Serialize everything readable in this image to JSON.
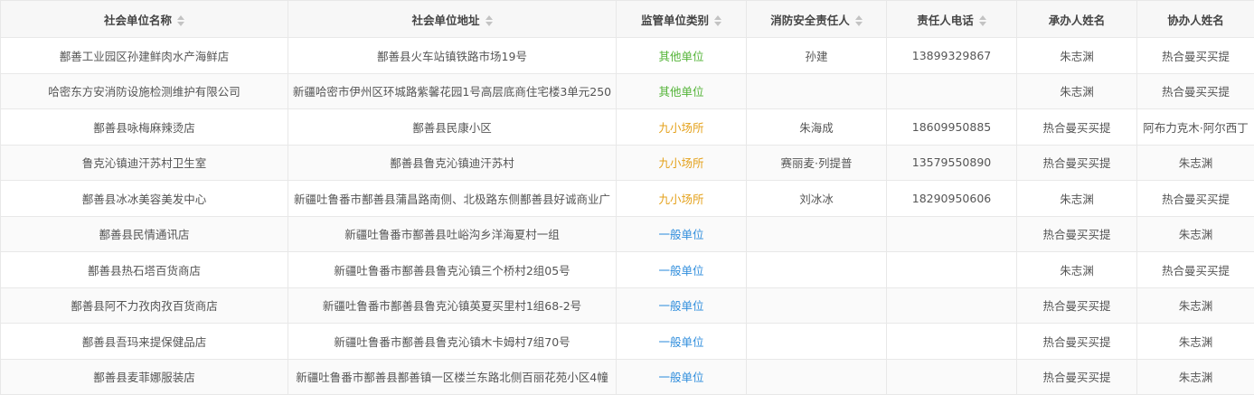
{
  "columns": [
    {
      "label": "社会单位名称",
      "sortable": true
    },
    {
      "label": "社会单位地址",
      "sortable": true
    },
    {
      "label": "监管单位类别",
      "sortable": true
    },
    {
      "label": "消防安全责任人",
      "sortable": true
    },
    {
      "label": "责任人电话",
      "sortable": true
    },
    {
      "label": "承办人姓名",
      "sortable": false
    },
    {
      "label": "协办人姓名",
      "sortable": false
    }
  ],
  "category_colors": {
    "其他单位": "#52b336",
    "九小场所": "#e4a11b",
    "一般单位": "#2f8ddc"
  },
  "rows": [
    {
      "name": "鄯善工业园区孙建鲜肉水产海鲜店",
      "address": "鄯善县火车站镇铁路市场19号",
      "category": "其他单位",
      "person": "孙建",
      "phone": "13899329867",
      "handler": "朱志渊",
      "assistant": "热合曼买买提"
    },
    {
      "name": "哈密东方安消防设施检测维护有限公司",
      "address": "新疆哈密市伊州区环城路紫馨花园1号高层底商住宅楼3单元250",
      "category": "其他单位",
      "person": "",
      "phone": "",
      "handler": "朱志渊",
      "assistant": "热合曼买买提"
    },
    {
      "name": "鄯善县咏梅麻辣烫店",
      "address": "鄯善县民康小区",
      "category": "九小场所",
      "person": "朱海成",
      "phone": "18609950885",
      "handler": "热合曼买买提",
      "assistant": "阿布力克木·阿尔西丁"
    },
    {
      "name": "鲁克沁镇迪汗苏村卫生室",
      "address": "鄯善县鲁克沁镇迪汗苏村",
      "category": "九小场所",
      "person": "赛丽麦·列提普",
      "phone": "13579550890",
      "handler": "热合曼买买提",
      "assistant": "朱志渊"
    },
    {
      "name": "鄯善县冰冰美容美发中心",
      "address": "新疆吐鲁番市鄯善县蒲昌路南侧、北极路东侧鄯善县好诚商业广",
      "category": "九小场所",
      "person": "刘冰冰",
      "phone": "18290950606",
      "handler": "朱志渊",
      "assistant": "热合曼买买提"
    },
    {
      "name": "鄯善县民情通讯店",
      "address": "新疆吐鲁番市鄯善县吐峪沟乡洋海夏村一组",
      "category": "一般单位",
      "person": "",
      "phone": "",
      "handler": "热合曼买买提",
      "assistant": "朱志渊"
    },
    {
      "name": "鄯善县热石塔百货商店",
      "address": "新疆吐鲁番市鄯善县鲁克沁镇三个桥村2组05号",
      "category": "一般单位",
      "person": "",
      "phone": "",
      "handler": "朱志渊",
      "assistant": "热合曼买买提"
    },
    {
      "name": "鄯善县阿不力孜肉孜百货商店",
      "address": "新疆吐鲁番市鄯善县鲁克沁镇英夏买里村1组68-2号",
      "category": "一般单位",
      "person": "",
      "phone": "",
      "handler": "热合曼买买提",
      "assistant": "朱志渊"
    },
    {
      "name": "鄯善县吾玛来提保健品店",
      "address": "新疆吐鲁番市鄯善县鲁克沁镇木卡姆村7组70号",
      "category": "一般单位",
      "person": "",
      "phone": "",
      "handler": "热合曼买买提",
      "assistant": "朱志渊"
    },
    {
      "name": "鄯善县麦菲娜服装店",
      "address": "新疆吐鲁番市鄯善县鄯善镇一区楼兰东路北侧百丽花苑小区4幢",
      "category": "一般单位",
      "person": "",
      "phone": "",
      "handler": "热合曼买买提",
      "assistant": "朱志渊"
    }
  ]
}
